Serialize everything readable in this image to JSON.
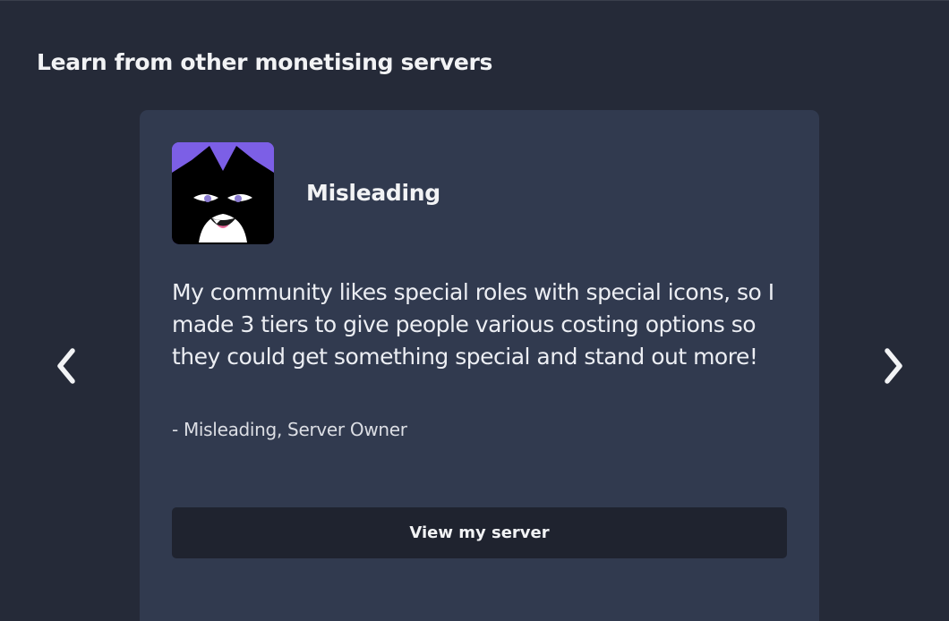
{
  "section": {
    "title": "Learn from other monetising servers"
  },
  "testimonial": {
    "server_name": "Misleading",
    "avatar_icon": "cat-mascot-avatar-icon",
    "avatar_bg_color": "#7c5fe6",
    "quote": "My community likes special roles with special icons, so I made 3 tiers to give people various costing options so they could get something special and stand out more!",
    "attribution": "- Misleading, Server Owner",
    "button_label": "View my server"
  },
  "carousel": {
    "prev_icon": "chevron-left-icon",
    "next_icon": "chevron-right-icon"
  },
  "colors": {
    "background": "#252a38",
    "card": "#313a4f",
    "button": "#1f232f",
    "text": "#f2f3f5"
  }
}
